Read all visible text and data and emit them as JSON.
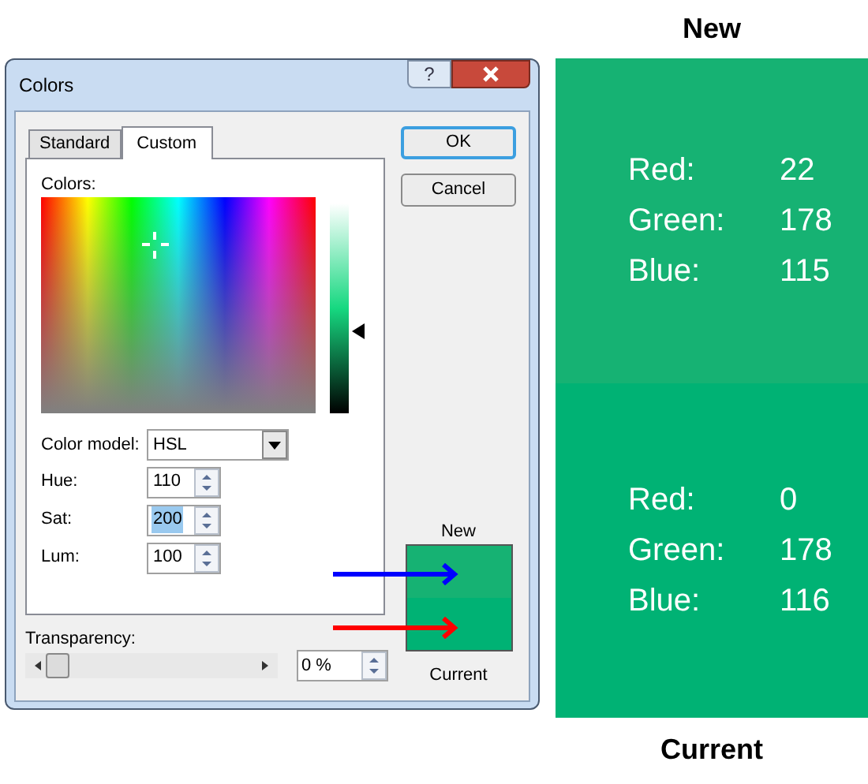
{
  "window": {
    "title": "Colors",
    "help": "?"
  },
  "tabs": [
    {
      "label": "Standard",
      "selected": false
    },
    {
      "label": "Custom",
      "selected": true
    }
  ],
  "colors_label": "Colors:",
  "color_model": {
    "label": "Color model:",
    "value": "HSL"
  },
  "fields": [
    {
      "label": "Hue:",
      "value": "110",
      "selected": false
    },
    {
      "label": "Sat:",
      "value": "200",
      "selected": true
    },
    {
      "label": "Lum:",
      "value": "100",
      "selected": false
    }
  ],
  "transparency": {
    "label": "Transparency:",
    "level": 0,
    "value": "0 %"
  },
  "buttons": [
    {
      "label": "OK",
      "default": true
    },
    {
      "label": "Cancel",
      "default": false
    }
  ],
  "preview": [
    {
      "label": "New",
      "color": "#16b273"
    },
    {
      "label": "Current",
      "color": "#00b274"
    }
  ],
  "panels": [
    {
      "heading": "New",
      "color": "#16b273",
      "rows": [
        {
          "label": "Red:",
          "value": "22"
        },
        {
          "label": "Green:",
          "value": "178"
        },
        {
          "label": "Blue:",
          "value": "115"
        }
      ]
    },
    {
      "heading": "Current",
      "color": "#00b274",
      "rows": [
        {
          "label": "Red:",
          "value": "0"
        },
        {
          "label": "Green:",
          "value": "178"
        },
        {
          "label": "Blue:",
          "value": "116"
        }
      ]
    }
  ]
}
